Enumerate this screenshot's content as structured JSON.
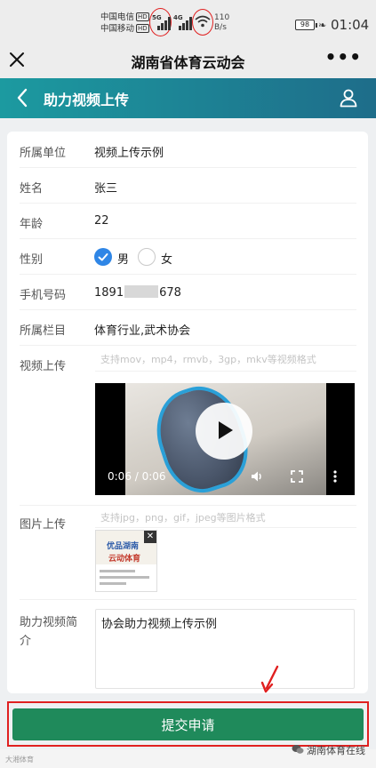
{
  "status_bar": {
    "carrier1": "中国电信",
    "carrier2": "中国移动",
    "hd": "HD",
    "net1": "5G",
    "net2": "4G",
    "speed1": "110",
    "speed2": "B/s",
    "battery": "98",
    "time": "01:04"
  },
  "wechat_nav": {
    "title": "湖南省体育云动会"
  },
  "header": {
    "title": "助力视频上传"
  },
  "form": {
    "unit_label": "所属单位",
    "unit_value": "视频上传示例",
    "name_label": "姓名",
    "name_value": "张三",
    "age_label": "年龄",
    "age_value": "22",
    "gender_label": "性别",
    "gender_options": [
      "男",
      "女"
    ],
    "gender_selected": "男",
    "phone_label": "手机号码",
    "phone_prefix": "1891",
    "phone_suffix": "678",
    "column_label": "所属栏目",
    "column_value": "体育行业,武术协会",
    "video_label": "视频上传",
    "video_hint": "支持mov，mp4，rmvb，3gp，mkv等视频格式",
    "video_time": "0:06 / 0:06",
    "image_label": "图片上传",
    "image_hint": "支持jpg，png，gif，jpeg等图片格式",
    "intro_label_line1": "助力视频简",
    "intro_label_line2": "介",
    "intro_value": "协会助力视频上传示例"
  },
  "thumbnail": {
    "line1": "优品湖南",
    "line2": "云动体育"
  },
  "submit_label": "提交申请",
  "watermark_left": "大湘体育",
  "watermark_right": "湖南体育在线",
  "colors": {
    "header_start": "#1c9aa0",
    "header_end": "#1e6d8a",
    "submit": "#1f8a5b",
    "radio_on": "#2f86e6",
    "annotation": "#e02020"
  },
  "icons": [
    "close-icon",
    "more-icon",
    "back-icon",
    "user-icon",
    "play-icon",
    "volume-icon",
    "fullscreen-icon",
    "video-more-icon",
    "check-icon",
    "thumb-close-icon",
    "wechat-icon"
  ]
}
